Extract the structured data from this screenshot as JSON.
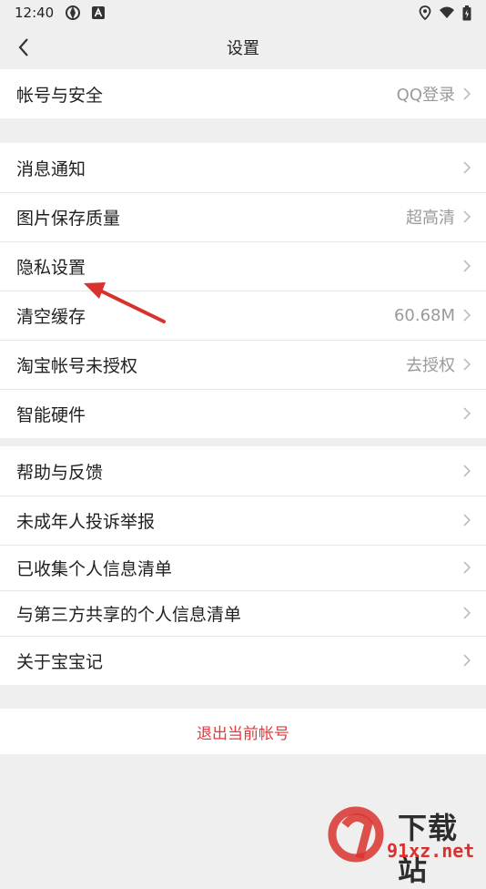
{
  "status_bar": {
    "time": "12:40",
    "left_icons": [
      "settings-sync-icon",
      "a-badge-icon"
    ],
    "right_icons": [
      "location-icon",
      "wifi-icon",
      "battery-icon"
    ]
  },
  "nav": {
    "title": "设置",
    "back_icon": "chevron-left-icon"
  },
  "groups": [
    {
      "items": [
        {
          "label": "帐号与安全",
          "value": "QQ登录"
        }
      ]
    },
    {
      "items": [
        {
          "label": "消息通知",
          "value": ""
        },
        {
          "label": "图片保存质量",
          "value": "超高清"
        },
        {
          "label": "隐私设置",
          "value": ""
        },
        {
          "label": "清空缓存",
          "value": "60.68M"
        },
        {
          "label": "淘宝帐号未授权",
          "value": "去授权"
        },
        {
          "label": "智能硬件",
          "value": ""
        }
      ]
    },
    {
      "items": [
        {
          "label": "帮助与反馈",
          "value": ""
        },
        {
          "label": "未成年人投诉举报",
          "value": ""
        },
        {
          "label": "已收集个人信息清单",
          "value": ""
        },
        {
          "label": "与第三方共享的个人信息清单",
          "value": ""
        },
        {
          "label": "关于宝宝记",
          "value": ""
        }
      ]
    }
  ],
  "logout": {
    "label": "退出当前帐号"
  },
  "annotation": {
    "arrow_color": "#d9322e"
  },
  "watermark": {
    "line1": "下载站",
    "line2": "91xz.net"
  },
  "colors": {
    "accent_red": "#e5383b",
    "page_bg": "#efefef"
  }
}
